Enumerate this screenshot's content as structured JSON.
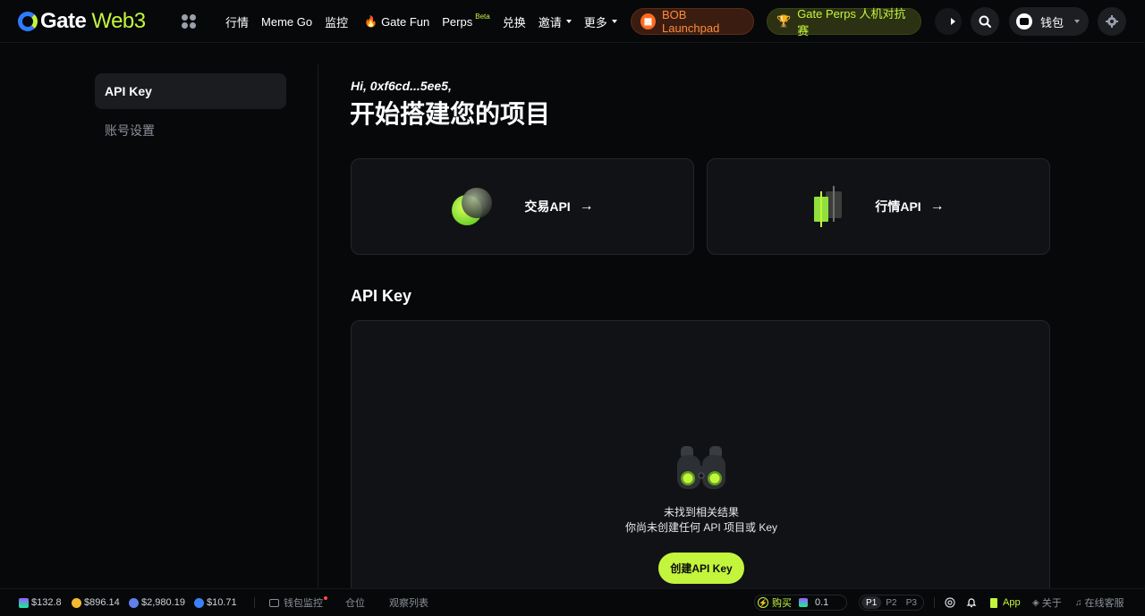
{
  "header": {
    "logo_gate": "Gate",
    "logo_web3": "Web3",
    "nav": [
      {
        "label": "行情"
      },
      {
        "label": "Meme Go"
      },
      {
        "label": "监控"
      },
      {
        "label": "Gate Fun",
        "icon": "fire-icon"
      },
      {
        "label": "Perps",
        "badge": "Beta"
      },
      {
        "label": "兑换"
      },
      {
        "label": "邀请",
        "dropdown": true
      },
      {
        "label": "更多",
        "dropdown": true
      }
    ],
    "promo_bob": "BOB Launchpad",
    "promo_perps": "Gate Perps 人机对抗赛",
    "wallet_label": "钱包",
    "accent_color": "#c3f53c"
  },
  "sidebar": {
    "items": [
      {
        "label": "API Key",
        "active": true
      },
      {
        "label": "账号设置",
        "active": false
      }
    ]
  },
  "main": {
    "greeting": "Hi, 0xf6cd...5ee5,",
    "headline": "开始搭建您的项目",
    "cards": [
      {
        "label": "交易API",
        "arrow": "→"
      },
      {
        "label": "行情API",
        "arrow": "→"
      }
    ],
    "section_title": "API Key",
    "empty": {
      "title": "未找到相关结果",
      "description": "你尚未创建任何 API 项目或 Key",
      "button": "创建API Key"
    }
  },
  "footer": {
    "prices": [
      {
        "value": "$132.8",
        "color": "#9b5cff"
      },
      {
        "value": "$896.14",
        "color": "#f3ba2f"
      },
      {
        "value": "$2,980.19",
        "color": "#627eea"
      },
      {
        "value": "$10.71",
        "color": "#3b82f6"
      }
    ],
    "links": [
      "钱包监控",
      "仓位",
      "观察列表"
    ],
    "buy_label": "购买",
    "buy_amount": "0.1",
    "presets": [
      "P1",
      "P2",
      "P3"
    ],
    "active_preset": "P1",
    "app_label": "App",
    "about_label": "关于",
    "support_label": "在线客服"
  }
}
